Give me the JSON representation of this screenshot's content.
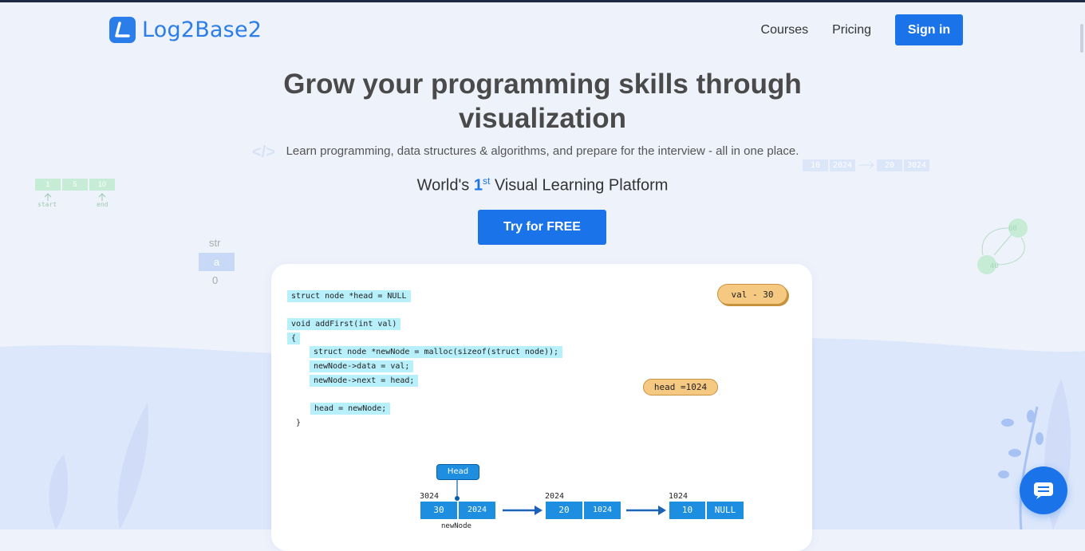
{
  "header": {
    "logo_text": "Log2Base2",
    "nav": [
      {
        "label": "Courses"
      },
      {
        "label": "Pricing"
      }
    ],
    "signin_label": "Sign in"
  },
  "hero": {
    "title": "Grow your programming skills through visualization",
    "subtitle": "Learn programming, data structures & algorithms, and prepare for the interview - all in one place.",
    "tagline_prefix": "World's ",
    "tagline_num": "1",
    "tagline_sup": "st",
    "tagline_suffix": " Visual Learning Platform",
    "cta_label": "Try for FREE"
  },
  "decor": {
    "array_cells": [
      "1",
      "5",
      "10"
    ],
    "array_start": "start",
    "array_end": "end",
    "str_label": "str",
    "str_char": "a",
    "str_index": "0",
    "ll_cells": [
      "10",
      "2024",
      "20",
      "3024"
    ],
    "graph_nodes": [
      "60",
      "40"
    ],
    "code_tag": "</>"
  },
  "card": {
    "code_lines": [
      "struct node *head = NULL",
      "void addFirst(int val)",
      "{",
      "struct node *newNode = malloc(sizeof(struct node));",
      "newNode->data = val;",
      "newNode->next = head;",
      "head = newNode;",
      "}"
    ],
    "val_pill": "val - 30",
    "head_pill": "head =1024",
    "head_label": "Head",
    "nodes": [
      {
        "addr": "3024",
        "data": "30",
        "next": "2024"
      },
      {
        "addr": "2024",
        "data": "20",
        "next": "1024"
      },
      {
        "addr": "1024",
        "data": "10",
        "next": "NULL"
      }
    ],
    "new_node_label": "newNode"
  },
  "colors": {
    "accent": "#1a73e8",
    "code_highlight": "#b7effa",
    "pill": "#f6c983",
    "node": "#1e8ee0"
  },
  "icons": [
    "logo-icon",
    "chat-icon"
  ]
}
